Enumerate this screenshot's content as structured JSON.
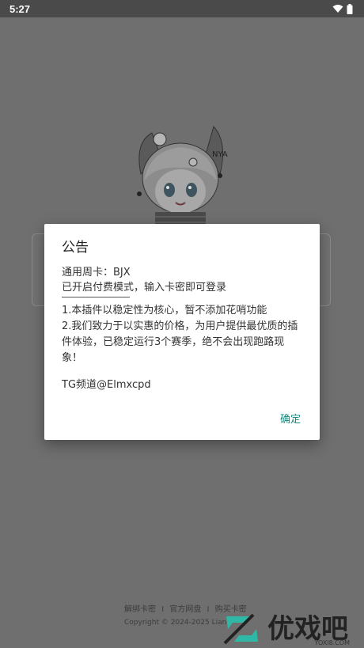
{
  "status_bar": {
    "time": "5:27"
  },
  "footer": {
    "links": [
      "解绑卡密",
      "官方网盘",
      "购买卡密"
    ],
    "separator": "I",
    "copyright": "Copyright © 2024-2025 Liang"
  },
  "watermark": {
    "brand": "优戏吧",
    "url": "YOXI8.COM"
  },
  "dialog": {
    "title": "公告",
    "line1": "通用周卡：BJX",
    "line2": "已开启付费模式，输入卡密即可登录",
    "para1": "1.本插件以稳定性为核心，暂不添加花哨功能",
    "para2": "2.我们致力于以实惠的价格，为用户提供最优质的插件体验，已稳定运行3个赛季，绝不会出现跑路现象！",
    "tg": "TG频道@Elmxcpd",
    "confirm_label": "确定"
  },
  "colors": {
    "accent": "#168a7e",
    "overlay": "#707070"
  },
  "icons": [
    "wifi-icon",
    "battery-icon"
  ]
}
